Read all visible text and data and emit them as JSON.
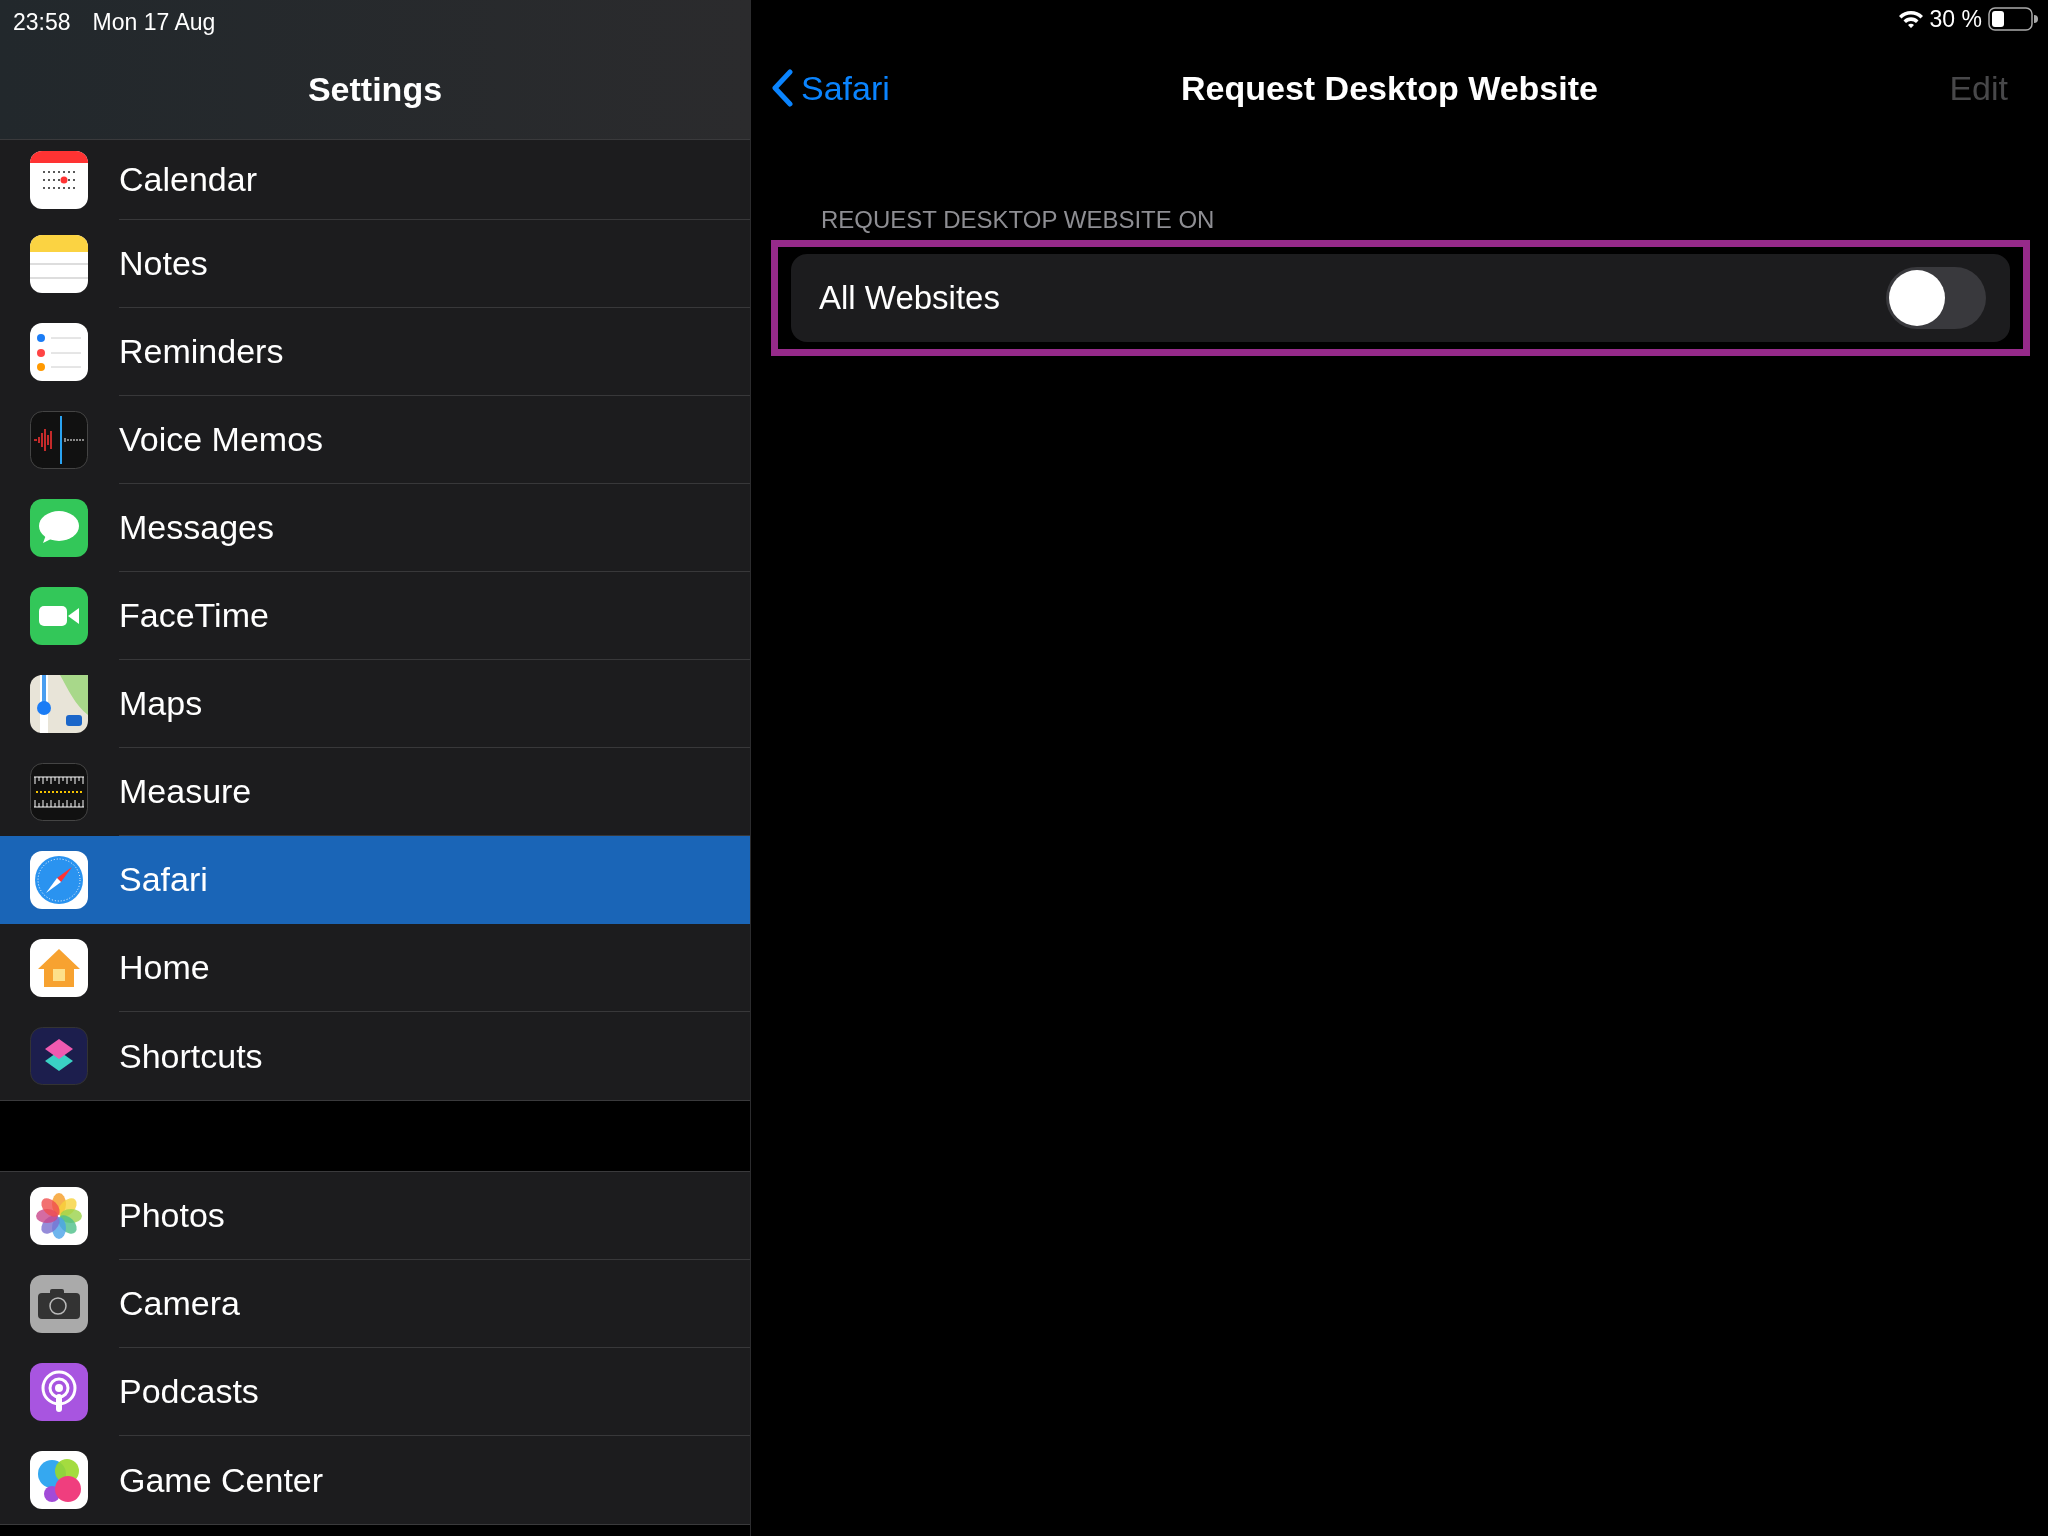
{
  "status_bar": {
    "time": "23:58",
    "date": "Mon 17 Aug",
    "battery": "30 %"
  },
  "sidebar": {
    "title": "Settings",
    "groups": [
      {
        "items": [
          {
            "label": "Calendar",
            "kind": "calendar",
            "selected": false
          },
          {
            "label": "Notes",
            "kind": "notes",
            "selected": false
          },
          {
            "label": "Reminders",
            "kind": "reminders",
            "selected": false
          },
          {
            "label": "Voice Memos",
            "kind": "voicememos",
            "selected": false
          },
          {
            "label": "Messages",
            "kind": "messages",
            "selected": false
          },
          {
            "label": "FaceTime",
            "kind": "facetime",
            "selected": false
          },
          {
            "label": "Maps",
            "kind": "maps",
            "selected": false
          },
          {
            "label": "Measure",
            "kind": "measure",
            "selected": false
          },
          {
            "label": "Safari",
            "kind": "safari",
            "selected": true
          },
          {
            "label": "Home",
            "kind": "home",
            "selected": false
          },
          {
            "label": "Shortcuts",
            "kind": "shortcuts",
            "selected": false
          }
        ]
      },
      {
        "items": [
          {
            "label": "Photos",
            "kind": "photos",
            "selected": false
          },
          {
            "label": "Camera",
            "kind": "camera",
            "selected": false
          },
          {
            "label": "Podcasts",
            "kind": "podcasts",
            "selected": false
          },
          {
            "label": "Game Center",
            "kind": "gamecenter",
            "selected": false
          }
        ]
      }
    ]
  },
  "detail": {
    "back": "Safari",
    "title": "Request Desktop Website",
    "edit": {
      "label": "Edit",
      "disabled": true
    },
    "section_header": "REQUEST DESKTOP WEBSITE ON",
    "rows": [
      {
        "label": "All Websites",
        "on": false,
        "highlighted": true
      }
    ]
  }
}
